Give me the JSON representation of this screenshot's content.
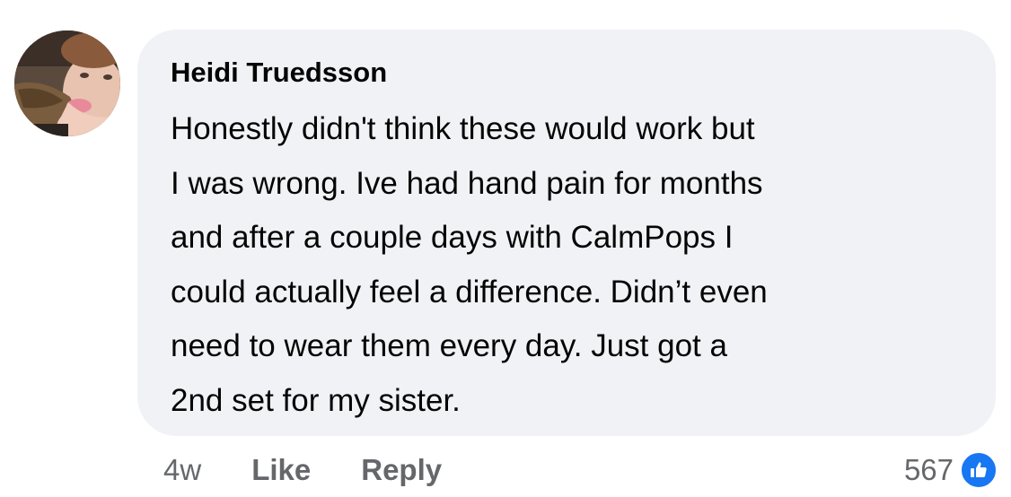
{
  "comment": {
    "author": "Heidi Truedsson",
    "text_lines": [
      "Honestly didn't think these would work but",
      "I was wrong. Ive had hand pain for months",
      "and after a couple days with CalmPops I",
      "could actually feel a difference. Didn’t even",
      "need to wear them every day. Just got a",
      "2nd set for my sister."
    ],
    "timestamp": "4w",
    "like_label": "Like",
    "reply_label": "Reply",
    "reaction_count": "567",
    "reaction_icon": "thumbs-up-icon"
  },
  "colors": {
    "bubble_background": "#f0f2f5",
    "meta_text": "#65676b",
    "like_blue": "#1877f2"
  }
}
